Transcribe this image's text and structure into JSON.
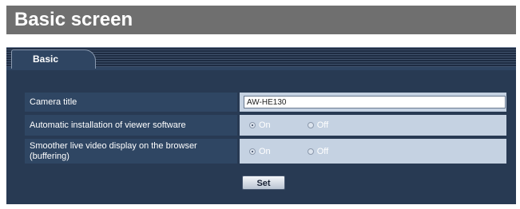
{
  "heading": "Basic screen",
  "tabs": [
    {
      "label": "Basic",
      "active": true
    }
  ],
  "rows": [
    {
      "label": "Camera title",
      "type": "text",
      "value": "AW-HE130"
    },
    {
      "label": "Automatic installation of viewer software",
      "type": "radio",
      "options": [
        "On",
        "Off"
      ],
      "selected": "On"
    },
    {
      "label": "Smoother live video display on the browser (buffering)",
      "type": "radio",
      "options": [
        "On",
        "Off"
      ],
      "selected": "On"
    }
  ],
  "set_button": "Set",
  "colors": {
    "panel": "#283a53",
    "label_cell": "#2f4663",
    "value_cell": "#c5d2e2",
    "heading_bg": "#6f6f6f"
  }
}
